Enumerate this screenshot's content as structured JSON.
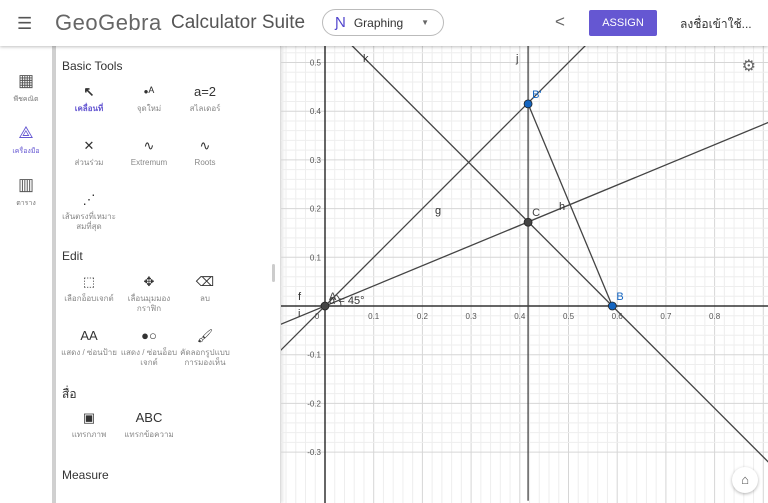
{
  "header": {
    "logo": "GeoGebra",
    "suite": "Calculator Suite",
    "app": "Graphing",
    "assign": "ASSIGN",
    "login": "ลงชื่อเข้าใช้..."
  },
  "rail": [
    {
      "label": "พีชคณิต",
      "icon": "calculator-icon"
    },
    {
      "label": "เครื่องมือ",
      "icon": "tools-icon",
      "active": true
    },
    {
      "label": "ตาราง",
      "icon": "table-icon"
    }
  ],
  "panel": {
    "basic_title": "Basic Tools",
    "basic": [
      {
        "label": "เคลื่อนที่",
        "icon": "↖"
      },
      {
        "label": "จุดใหม่",
        "icon": "•ᴬ"
      },
      {
        "label": "สไลเดอร์",
        "icon": "a=2"
      },
      {
        "label": "ส่วนร่วม",
        "icon": "✕"
      },
      {
        "label": "Extremum",
        "icon": "∿"
      },
      {
        "label": "Roots",
        "icon": "∿"
      },
      {
        "label": "เส้นตรงที่เหมาะสมที่สุด",
        "icon": "⋰"
      }
    ],
    "edit_title": "Edit",
    "edit": [
      {
        "label": "เลือกอ็อบเจกต์",
        "icon": "⬚"
      },
      {
        "label": "เลื่อนมุมมองกราฟิก",
        "icon": "✥"
      },
      {
        "label": "ลบ",
        "icon": "⌫"
      },
      {
        "label": "แสดง / ซ่อนป้าย",
        "icon": "AA"
      },
      {
        "label": "แสดง / ซ่อนอ็อบเจกต์",
        "icon": "●○"
      },
      {
        "label": "คัดลอกรูปแบบการมองเห็น",
        "icon": "🖌"
      }
    ],
    "media_title": "สื่อ",
    "media": [
      {
        "label": "แทรกภาพ",
        "icon": "▣"
      },
      {
        "label": "แทรกข้อความ",
        "icon": "ABC"
      }
    ],
    "measure_title": "Measure"
  },
  "graph": {
    "x_ticks": [
      "0",
      "0.1",
      "0.2",
      "0.3",
      "0.4",
      "0.5",
      "0.6",
      "0.7",
      "0.8"
    ],
    "y_ticks": [
      "0.5",
      "0.4",
      "0.3",
      "0.2",
      "0.1",
      "-0.1",
      "-0.2",
      "-0.3"
    ],
    "points": [
      {
        "name": "A",
        "x": 0,
        "y": 0,
        "color": "#444"
      },
      {
        "name": "B",
        "x": 0.59,
        "y": 0,
        "color": "#1565c0"
      },
      {
        "name": "B'",
        "x": 0.417,
        "y": 0.415,
        "color": "#1565c0"
      },
      {
        "name": "C",
        "x": 0.417,
        "y": 0.172,
        "color": "#444"
      }
    ],
    "line_labels": {
      "k": "k",
      "j": "j",
      "g": "g",
      "h": "h",
      "f": "f",
      "i": "i"
    },
    "angle_label": "α = 45°"
  }
}
